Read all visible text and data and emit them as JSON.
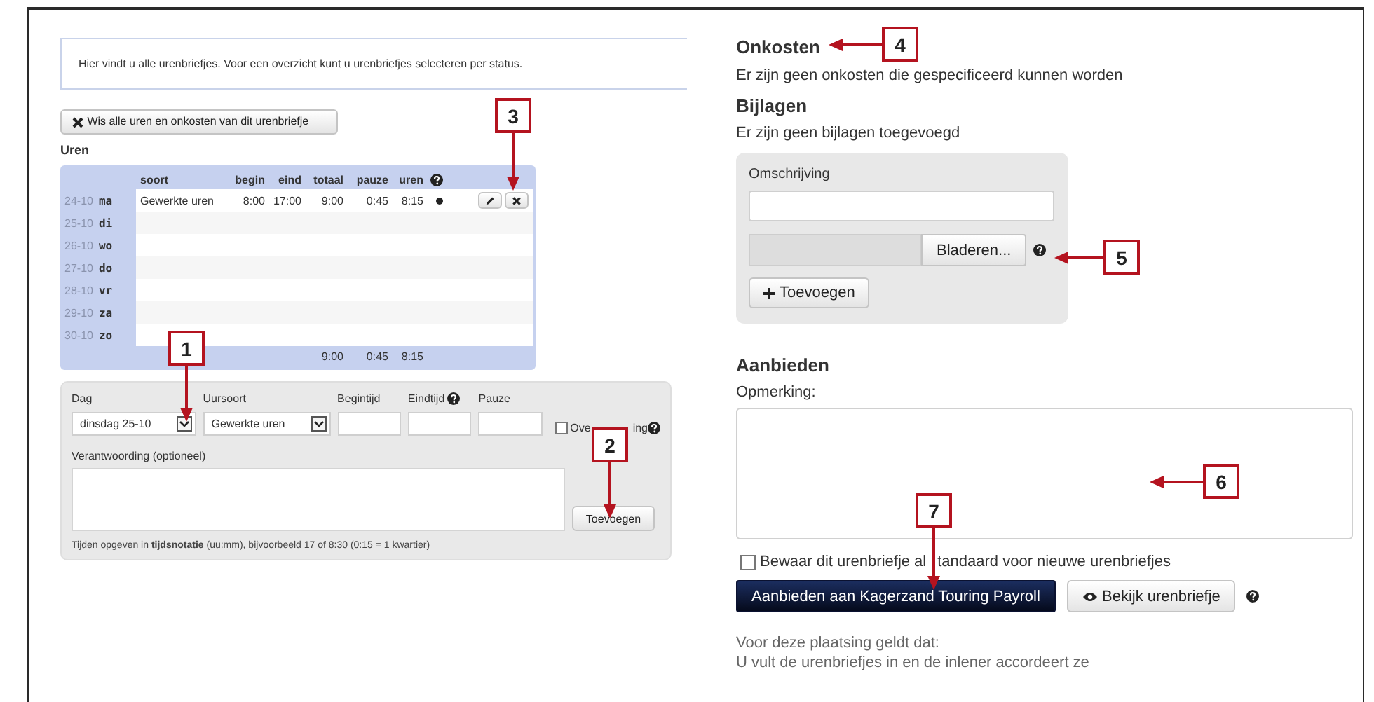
{
  "info_text": "Hier vindt u alle urenbriefjes. Voor een overzicht kunt u urenbriefjes selecteren per status.",
  "clear_button": {
    "label": "Wis alle uren en onkosten van dit urenbriefje"
  },
  "hours": {
    "title": "Uren",
    "columns": [
      "soort",
      "begin",
      "eind",
      "totaal",
      "pauze",
      "uren"
    ],
    "rows": [
      {
        "date": "24-10",
        "day": "ma",
        "kind": "entry",
        "cells": [
          "Gewerkte uren",
          "8:00",
          "17:00",
          "9:00",
          "0:45",
          "8:15"
        ]
      },
      {
        "date": "25-10",
        "day": "di",
        "kind": "empty"
      },
      {
        "date": "26-10",
        "day": "wo",
        "kind": "empty"
      },
      {
        "date": "27-10",
        "day": "do",
        "kind": "empty"
      },
      {
        "date": "28-10",
        "day": "vr",
        "kind": "empty"
      },
      {
        "date": "29-10",
        "day": "za",
        "kind": "empty"
      },
      {
        "date": "30-10",
        "day": "zo",
        "kind": "empty"
      }
    ],
    "totals": [
      "9:00",
      "0:45",
      "8:15"
    ]
  },
  "entry_form": {
    "fields": [
      {
        "label": "Dag",
        "kind": "select",
        "value": "dinsdag 25-10"
      },
      {
        "label": "Uursoort",
        "kind": "select",
        "value": "Gewerkte uren"
      },
      {
        "label": "Begintijd",
        "kind": "text"
      },
      {
        "label": "Eindtijd",
        "kind": "text",
        "help": true
      },
      {
        "label": "Pauze",
        "kind": "text"
      }
    ],
    "overtime": {
      "label_parts": [
        "Ove",
        "ing"
      ],
      "checked": false
    },
    "note_label": "Verantwoording (optioneel)",
    "add_button": "Toevoegen",
    "hint": "Tijden opgeven in **tijdsnotatie** (uu:mm), bijvoorbeeld 17 of 8:30 (0:15 = 1 kwartier)"
  },
  "expenses": {
    "title": "Onkosten",
    "text": "Er zijn geen onkosten die gespecificeerd kunnen worden"
  },
  "attachments": {
    "title": "Bijlagen",
    "text": "Er zijn geen bijlagen toegevoegd",
    "description_label": "Omschrijving",
    "browse_button": "Bladeren...",
    "add_button": "Toevoegen"
  },
  "submit": {
    "title": "Aanbieden",
    "remark_label": "Opmerking:",
    "save_default": {
      "label_parts": [
        "Bewaar dit urenbriefje al",
        "tandaard voor nieuwe urenbriefjes"
      ],
      "checked": false
    },
    "submit_button": "Aanbieden aan Kagerzand Touring  Payroll",
    "view_button": "Bekijk urenbriefje",
    "notes": [
      "Voor deze plaatsing geldt dat:",
      "U vult de urenbriefjes in en de inlener accordeert ze"
    ]
  },
  "callouts": [
    {
      "label": "1"
    },
    {
      "label": "2"
    },
    {
      "label": "3"
    },
    {
      "label": "4"
    },
    {
      "label": "5"
    },
    {
      "label": "6"
    },
    {
      "label": "7"
    }
  ]
}
